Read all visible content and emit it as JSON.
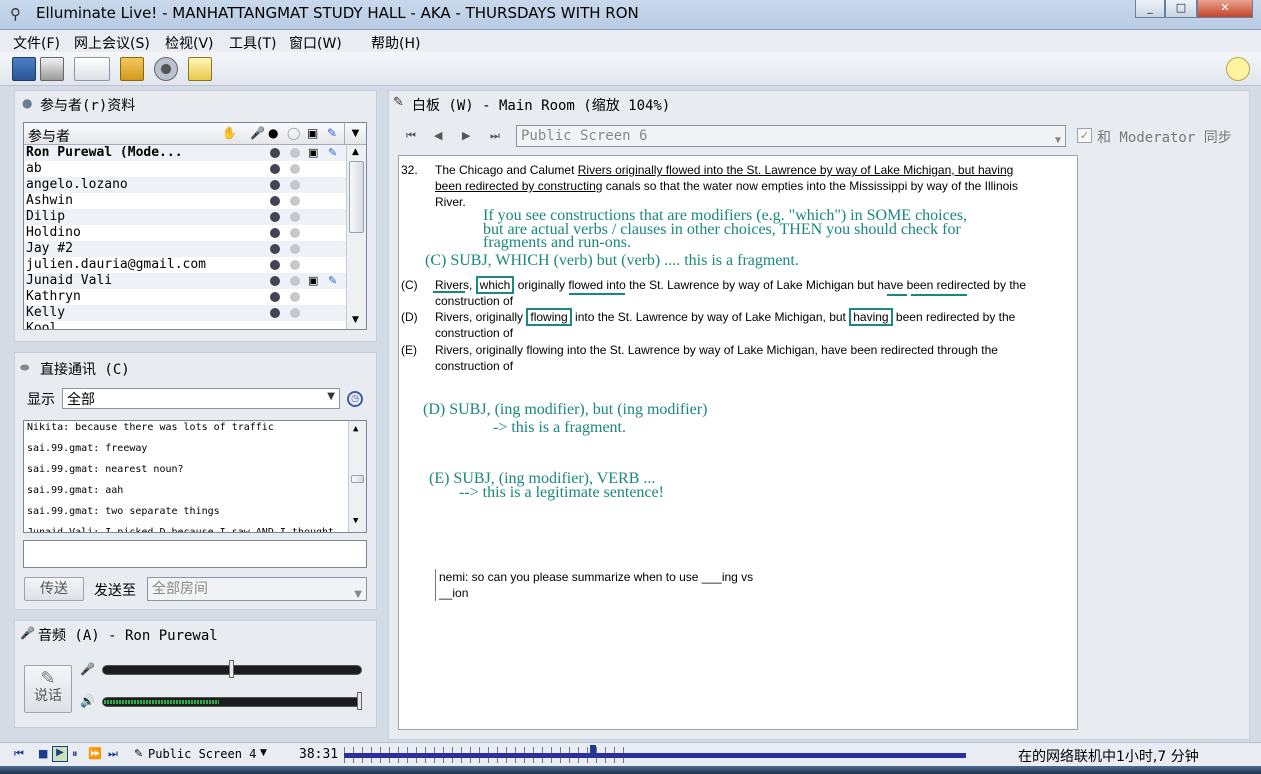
{
  "window": {
    "title": "Elluminate Live! - MANHATTANGMAT STUDY HALL - AKA - THURSDAYS WITH RON",
    "controls": [
      "_",
      "□",
      "✕"
    ]
  },
  "menu": [
    "文件(F)",
    "网上会议(S)",
    "检视(V)",
    "工具(T)",
    "窗口(W)",
    "帮助(H)"
  ],
  "participants": {
    "section_title": "参与者(r)资料",
    "column_header": "参与者",
    "rows": [
      "Ron Purewal (Mode...",
      "ab",
      "angelo.lozano",
      "Ashwin",
      "Dilip",
      "Holdino",
      "Jay #2",
      "julien.dauria@gmail.com",
      "Junaid Vali",
      "Kathryn",
      "Kelly",
      "Kool"
    ]
  },
  "direct_messaging": {
    "section_title": "直接通讯 (C)",
    "show_label": "显示",
    "show_value": "全部",
    "messages": [
      "Nikita: because there was lots of traffic",
      "sai.99.gmat: freeway",
      "sai.99.gmat: nearest noun?",
      "sai.99.gmat: aah",
      "sai.99.gmat: two separate things",
      "Junaid Vali: I picked D because I saw AND I thought"
    ],
    "send_label": "传送",
    "send_to_label": "发送至",
    "send_to_value": "全部房间"
  },
  "audio": {
    "section_title": "音频 (A) - Ron Purewal",
    "talk_label": "说话",
    "mic_level": 0.5,
    "speaker_level": 1.0
  },
  "whiteboard": {
    "section_title": "白板 (W) - Main Room (缩放 104%)",
    "screen_name": "Public Screen 6",
    "sync_label": "和 Moderator 同步",
    "question": {
      "number": "32.",
      "stem_a": "The Chicago and Calumet ",
      "stem_underlined_1": "Rivers originally flowed into the St. Lawrence by way of Lake Michigan, but having",
      "stem_underlined_2": "been redirected by constructing",
      "stem_b": " canals so that the water now empties into the Mississippi by way of the Illinois",
      "stem_c": "River.",
      "choice_c_label": "(C)",
      "choice_c_1": "Rivers, ",
      "choice_c_which": "which",
      "choice_c_2": " originally flowed into the St. Lawrence by way of Lake Michigan but have been redirected by the",
      "choice_c_3": "construction of",
      "choice_d_label": "(D)",
      "choice_d_1": "Rivers, originally ",
      "choice_d_flowing": "flowing",
      "choice_d_2": " into the St. Lawrence by way of Lake Michigan, but ",
      "choice_d_having": "having",
      "choice_d_3": " been redirected by the",
      "choice_d_4": "construction of",
      "choice_e_label": "(E)",
      "choice_e_1": "Rivers, originally flowing into the St. Lawrence by way of Lake Michigan, have been redirected through the",
      "choice_e_2": "construction of"
    },
    "annotations": {
      "note_1a": "If you see constructions that are modifiers (e.g. \"which\") in SOME choices,",
      "note_1b": "but are actual verbs / clauses in other choices, THEN you should check for",
      "note_1c": "fragments and run-ons.",
      "note_c": "(C)   SUBJ,  WHICH (verb) but (verb) ....     this is a fragment.",
      "note_d1": "(D) SUBJ, (ing modifier), but (ing modifier)",
      "note_d2": "-> this is a fragment.",
      "note_e1": "(E) SUBJ, (ing modifier), VERB ...",
      "note_e2": "--> this is a legitimate sentence!"
    },
    "typed_note_1": "nemi: so can you please summarize when to use ___ing vs",
    "typed_note_2": "__ion"
  },
  "status": {
    "screen_name": "Public Screen 4",
    "time": "38:31",
    "online_text": "在的网络联机中1小时,7 分钟"
  },
  "colors": {
    "annotation": "#19877c",
    "title_bar": "#c9d9ec",
    "panel_bg": "#e8ecf1"
  }
}
